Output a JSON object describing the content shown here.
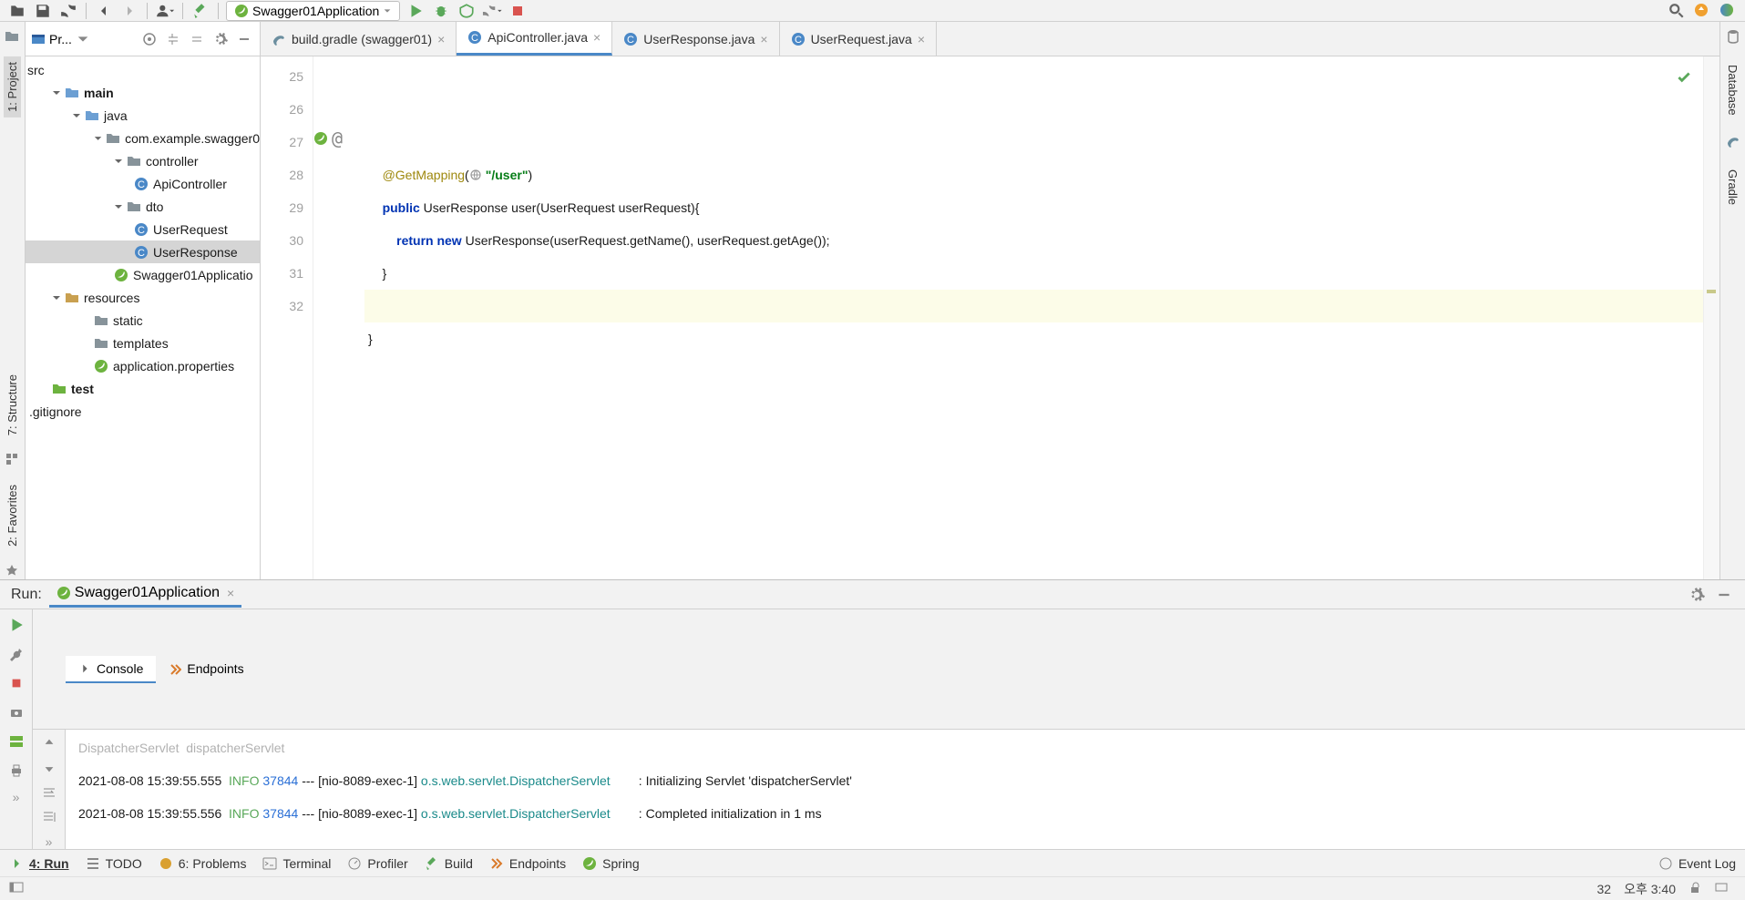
{
  "toolbar": {
    "run_config": "Swagger01Application"
  },
  "left_tabs": {
    "project": "1: Project",
    "structure": "7: Structure",
    "favorites": "2: Favorites"
  },
  "right_tabs": {
    "database": "Database",
    "gradle": "Gradle"
  },
  "project_panel": {
    "title": "Pr..."
  },
  "tree": {
    "src": "src",
    "main": "main",
    "java": "java",
    "pkg": "com.example.swagger0",
    "controller": "controller",
    "apiController": "ApiController",
    "dto": "dto",
    "userRequest": "UserRequest",
    "userResponse": "UserResponse",
    "swaggerApp": "Swagger01Applicatio",
    "resources": "resources",
    "static": "static",
    "templates": "templates",
    "appProps": "application.properties",
    "test": "test",
    "gitignore": ".gitignore"
  },
  "editor": {
    "tabs": [
      {
        "label": "build.gradle (swagger01)",
        "icon": "gradle"
      },
      {
        "label": "ApiController.java",
        "icon": "class",
        "active": true
      },
      {
        "label": "UserResponse.java",
        "icon": "class"
      },
      {
        "label": "UserRequest.java",
        "icon": "class"
      }
    ],
    "lines": [
      "25",
      "26",
      "27",
      "28",
      "29",
      "30",
      "31",
      "32"
    ],
    "code": {
      "l26_ann": "@GetMapping",
      "l26_open": "(",
      "l26_str": "\"/user\"",
      "l26_close": ")",
      "l27_pub": "public",
      "l27_rest": " UserResponse user(UserRequest userRequest){",
      "l28_ret": "return",
      "l28_new": "new",
      "l28_rest": " UserResponse(userRequest.getName(), userRequest.getAge());",
      "l29": "    }",
      "l31": "}"
    }
  },
  "run": {
    "label": "Run:",
    "config": "Swagger01Application",
    "tab_console": "Console",
    "tab_endpoints": "Endpoints",
    "console_lines": [
      "DispatcherServlet  dispatcherServlet",
      "2021-08-08 15:39:55.555  |INFO| |37844| --- [nio-8089-exec-1] |o.s.web.servlet.DispatcherServlet|        : Initializing Servlet 'dispatcherServlet'",
      "2021-08-08 15:39:55.556  |INFO| |37844| --- [nio-8089-exec-1] |o.s.web.servlet.DispatcherServlet|        : Completed initialization in 1 ms"
    ]
  },
  "bottom_tabs": {
    "run": "4: Run",
    "todo": "TODO",
    "problems": "6: Problems",
    "terminal": "Terminal",
    "profiler": "Profiler",
    "build": "Build",
    "endpoints": "Endpoints",
    "spring": "Spring",
    "event_log": "Event Log"
  },
  "status": {
    "col": "32",
    "time": "오후 3:40"
  }
}
